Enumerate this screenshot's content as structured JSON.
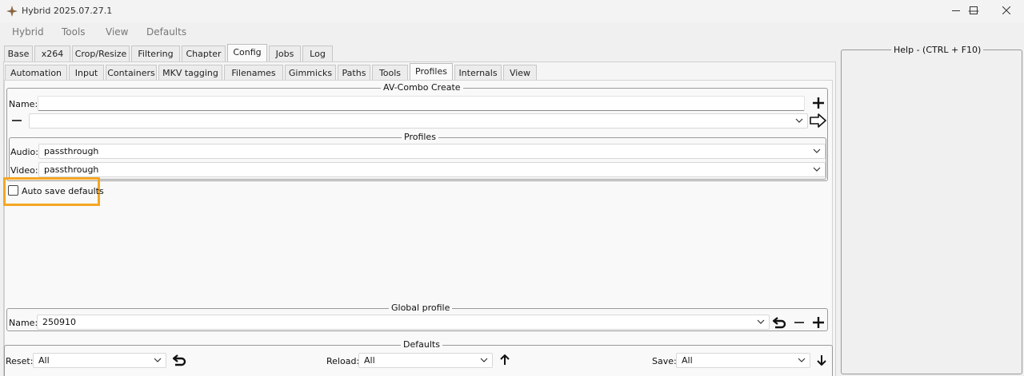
{
  "window": {
    "title": "Hybrid 2025.07.27.1",
    "controls": {
      "minimize": "—",
      "maximize": "☐",
      "close": "✕"
    }
  },
  "menu": [
    "Hybrid",
    "Tools",
    "View",
    "Defaults"
  ],
  "main_tabs": [
    "Base",
    "x264",
    "Crop/Resize",
    "Filtering",
    "Chapter",
    "Config",
    "Jobs",
    "Log"
  ],
  "main_tab_selected": "Config",
  "sub_tabs": [
    "Automation",
    "Input",
    "Containers",
    "MKV tagging",
    "Filenames",
    "Gimmicks",
    "Paths",
    "Tools",
    "Profiles",
    "Internals",
    "View"
  ],
  "sub_tab_selected": "Profiles",
  "av_combo": {
    "title": "AV-Combo Create",
    "name_label": "Name:",
    "name_value": "",
    "select_value": ""
  },
  "profiles": {
    "title": "Profiles",
    "audio_label": "Audio:",
    "audio_value": "passthrough",
    "video_label": "Video:",
    "video_value": "passthrough"
  },
  "auto_save": {
    "label": "Auto save defaults",
    "checked": false
  },
  "global_profile": {
    "title": "Global profile",
    "name_label": "Name:",
    "name_value": "250910"
  },
  "defaults": {
    "title": "Defaults",
    "reset_label": "Reset:",
    "reset_value": "All",
    "reload_label": "Reload:",
    "reload_value": "All",
    "save_label": "Save:",
    "save_value": "All"
  },
  "help": {
    "title": "Help - (CTRL + F10)"
  },
  "colors": {
    "highlight": "#f5a623"
  }
}
